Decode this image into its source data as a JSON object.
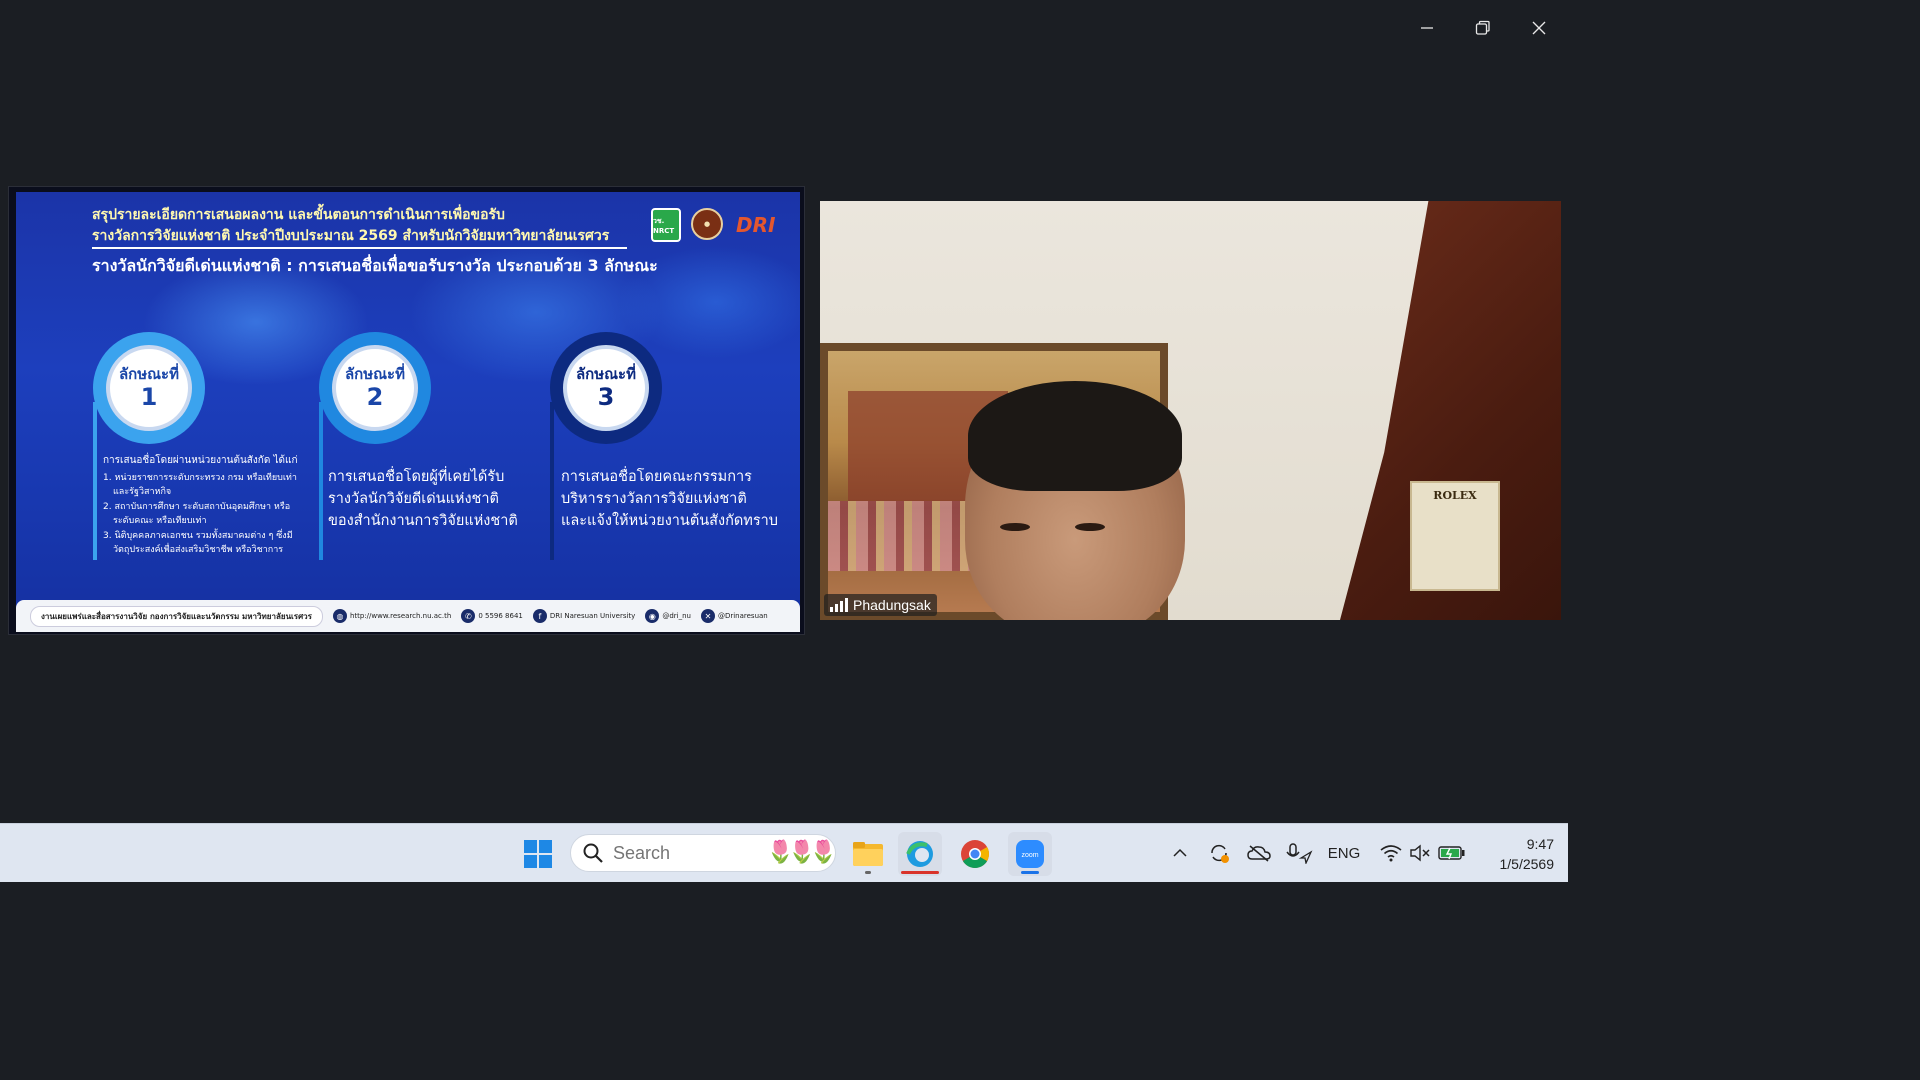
{
  "window": {
    "controls": {
      "minimize": "minimize",
      "restore": "restore",
      "close": "close"
    }
  },
  "slide": {
    "title_line1": "สรุปรายละเอียดการเสนอผลงาน และขั้นตอนการดำเนินการเพื่อขอรับ",
    "title_line2": "รางวัลการวิจัยแห่งชาติ ประจำปีงบประมาณ 2569 สำหรับนักวิจัยมหาวิทยาลัยนเรศวร",
    "subtitle": "รางวัลนักวิจัยดีเด่นแห่งชาติ : การเสนอชื่อเพื่อขอรับรางวัล ประกอบด้วย 3 ลักษณะ",
    "logos": {
      "nrct": "วช. NRCT",
      "dri": "DRI"
    },
    "features": [
      {
        "label": "ลักษณะที่",
        "number": "1"
      },
      {
        "label": "ลักษณะที่",
        "number": "2"
      },
      {
        "label": "ลักษณะที่",
        "number": "3"
      }
    ],
    "desc1": {
      "intro": "การเสนอชื่อโดยผ่านหน่วยงานต้นสังกัด ได้แก่",
      "items": [
        "1. หน่วยราชการระดับกระทรวง กรม หรือเทียบเท่า",
        "และรัฐวิสาหกิจ",
        "2. สถาบันการศึกษา ระดับสถาบันอุดมศึกษา หรือ",
        "ระดับคณะ หรือเทียบเท่า",
        "3. นิติบุคคลภาคเอกชน รวมทั้งสมาคมต่าง ๆ ซึ่งมี",
        "วัตถุประสงค์เพื่อส่งเสริมวิชาชีพ หรือวิชาการ"
      ]
    },
    "desc2": [
      "การเสนอชื่อโดยผู้ที่เคยได้รับ",
      "รางวัลนักวิจัยดีเด่นแห่งชาติ",
      "ของสำนักงานการวิจัยแห่งชาติ"
    ],
    "desc3": [
      "การเสนอชื่อโดยคณะกรรมการ",
      "บริหารรางวัลการวิจัยแห่งชาติ",
      "และแจ้งให้หน่วยงานต้นสังกัดทราบ"
    ],
    "footer": {
      "org": "งานเผยแพร่และสื่อสารงานวิจัย กองการวิจัยและนวัตกรรม มหาวิทยาลัยนเรศวร",
      "website": "http://www.research.nu.ac.th",
      "phone": "0 5596 8641",
      "facebook": "DRI Naresuan University",
      "line": "@dri_nu",
      "x": "@Drinaresuan"
    }
  },
  "video": {
    "participant_name": "Phadungsak",
    "box_text": "ROLEX"
  },
  "taskbar": {
    "search_placeholder": "Search",
    "tray": {
      "language": "ENG"
    },
    "clock": {
      "time": "9:47",
      "date": "1/5/2569"
    }
  },
  "colors": {
    "zoom_active": "#1a73e8",
    "edge_active": "#d9342b",
    "slide_blue": "#1d3fbd"
  }
}
